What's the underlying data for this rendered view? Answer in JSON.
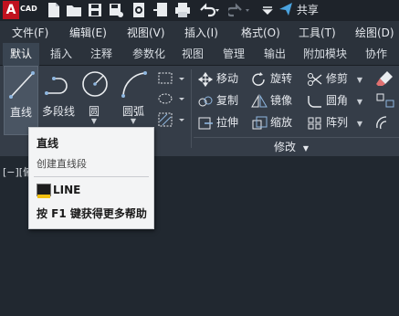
{
  "app": {
    "logo_letter": "A",
    "logo_text": "CAD",
    "share_label": "共享"
  },
  "menubar": {
    "items": [
      "文件(F)",
      "编辑(E)",
      "视图(V)",
      "插入(I)",
      "格式(O)",
      "工具(T)",
      "绘图(D)"
    ]
  },
  "tabs": {
    "items": [
      "默认",
      "插入",
      "注释",
      "参数化",
      "视图",
      "管理",
      "输出",
      "附加模块",
      "协作"
    ],
    "active": "默认"
  },
  "draw": {
    "line_label": "直线",
    "polyline_label": "多段线",
    "circle_label": "圆",
    "arc_label": "圆弧"
  },
  "modify": {
    "group_label": "修改",
    "items": [
      {
        "label": "移动",
        "icon": "move-icon"
      },
      {
        "label": "旋转",
        "icon": "rotate-icon"
      },
      {
        "label": "修剪",
        "icon": "trim-icon"
      },
      {
        "label": "复制",
        "icon": "copy-icon"
      },
      {
        "label": "镜像",
        "icon": "mirror-icon"
      },
      {
        "label": "圆角",
        "icon": "fillet-icon"
      },
      {
        "label": "拉伸",
        "icon": "stretch-icon"
      },
      {
        "label": "缩放",
        "icon": "scale-icon"
      },
      {
        "label": "阵列",
        "icon": "array-icon"
      }
    ]
  },
  "viewport": {
    "label": "[−][俯"
  },
  "tooltip": {
    "title": "直线",
    "description": "创建直线段",
    "command": "LINE",
    "help": "按 F1 键获得更多帮助"
  },
  "colors": {
    "accent": "#c1121f",
    "ribbon_bg": "#353d48",
    "viewport_bg": "#212830",
    "tooltip_bg": "#f3f4f5"
  }
}
